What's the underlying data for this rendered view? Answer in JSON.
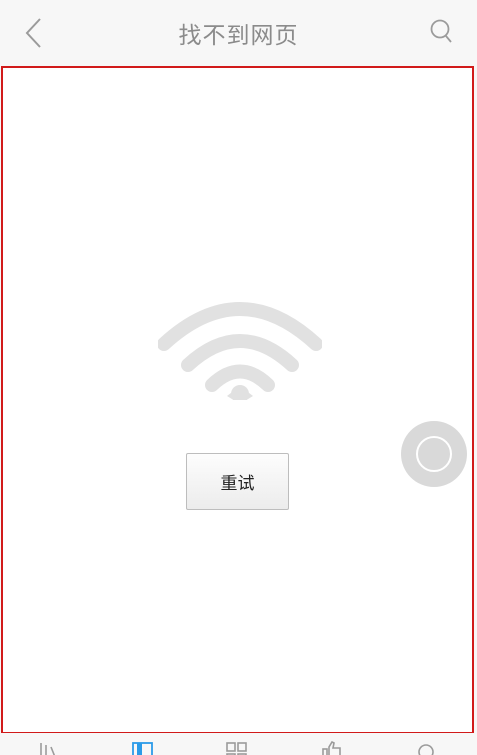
{
  "header": {
    "title": "找不到网页"
  },
  "error_page": {
    "retry_label": "重试",
    "illustration": "wifi-icon"
  },
  "bottom_nav": {
    "items": [
      {
        "icon": "bars-icon",
        "active": false
      },
      {
        "icon": "bookmark-icon",
        "active": true
      },
      {
        "icon": "grid-icon",
        "active": false
      },
      {
        "icon": "thumb-icon",
        "active": false
      },
      {
        "icon": "search-icon",
        "active": false
      }
    ]
  },
  "colors": {
    "accent": "#2b9be8",
    "error_border": "#d11a1a",
    "title_text": "#8b8b8b",
    "icon_gray": "#9b9b9b",
    "float_ball": "#d9d9d9"
  }
}
